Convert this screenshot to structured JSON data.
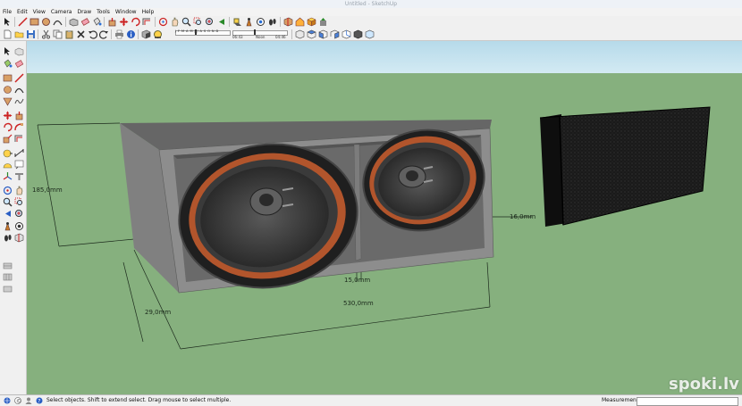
{
  "window": {
    "title": "Untitled - SketchUp"
  },
  "menu": [
    "File",
    "Edit",
    "View",
    "Camera",
    "Draw",
    "Tools",
    "Window",
    "Help"
  ],
  "toolbar": {
    "letter_scale": "J F M A M J J A S O N D",
    "time_labels": {
      "am": "06:43",
      "noon": "Noon",
      "pm": "04:46"
    }
  },
  "dimensions": {
    "height": "185,0mm",
    "depth": "29,0mm",
    "width": "530,0mm",
    "panel": "15,0mm",
    "side": "16,0mm"
  },
  "status": {
    "hint": "Select objects. Shift to extend select. Drag mouse to select multiple.",
    "measurements_label": "Measurements",
    "measurements_value": ""
  },
  "watermark": "spoki.lv",
  "colors": {
    "sky": "#b8dcec",
    "ground": "#86b07e",
    "box": "#8a8a8a",
    "woofer_ring": "#b2552c"
  }
}
